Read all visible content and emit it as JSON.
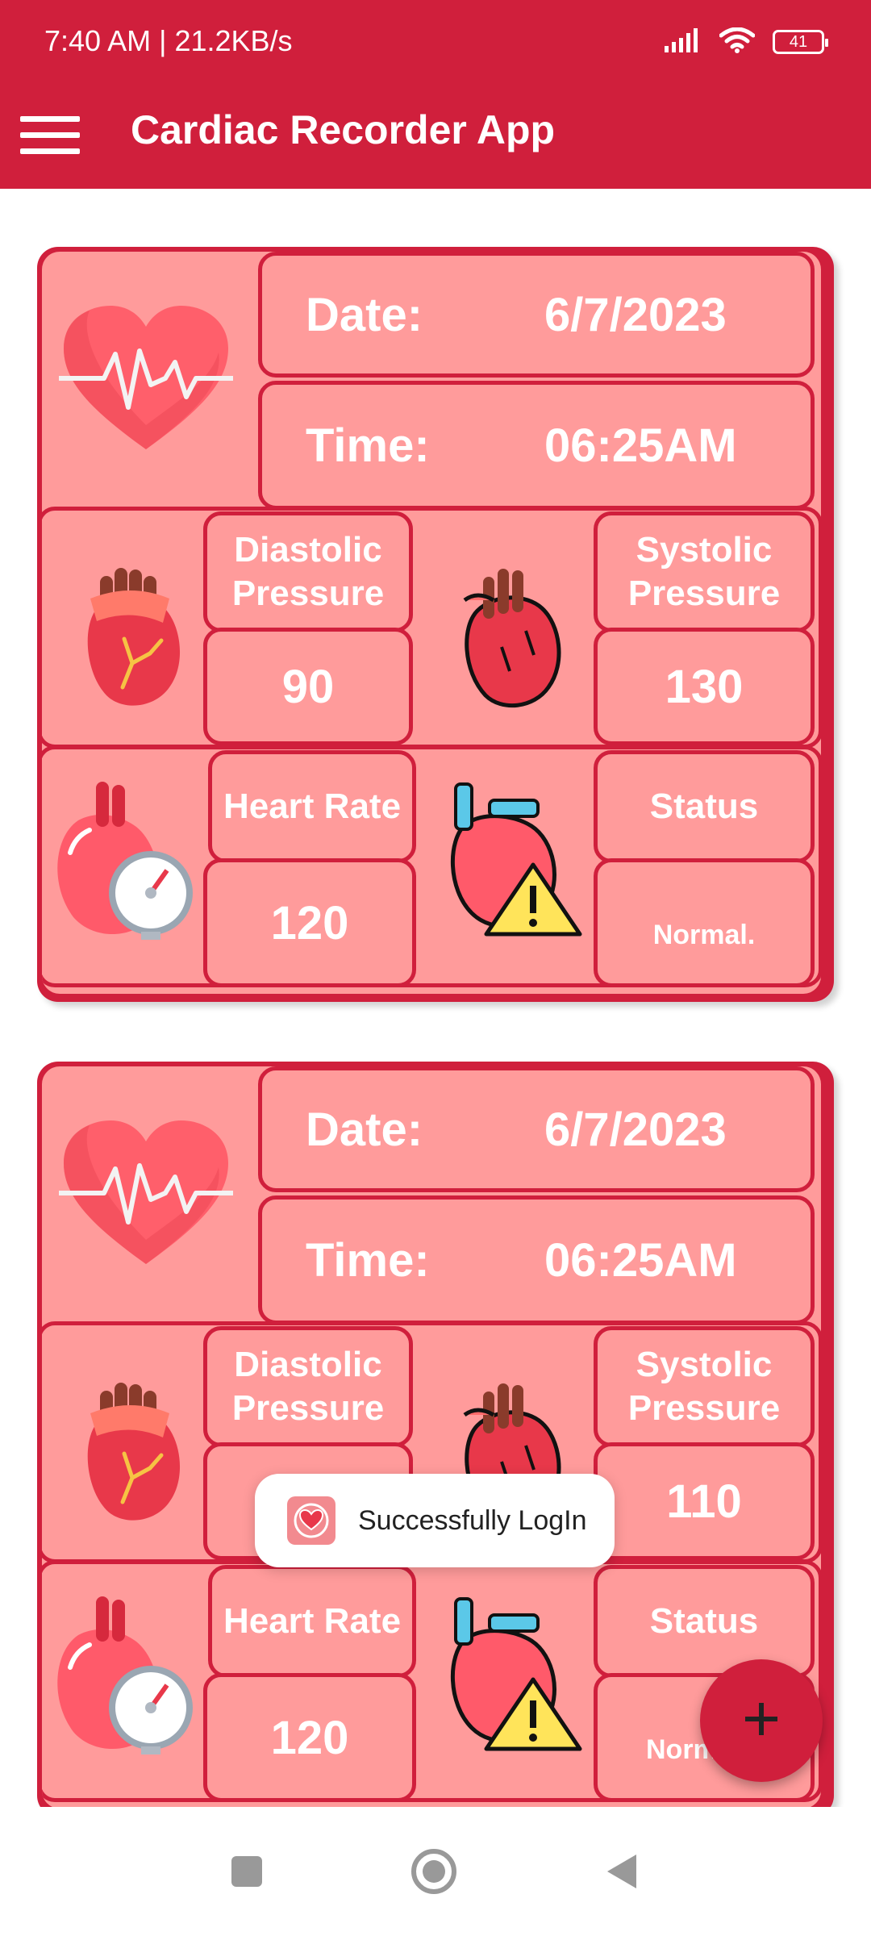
{
  "status_bar": {
    "time": "7:40 AM | 21.2KB/s",
    "battery": "41",
    "icons": [
      "signal-icon",
      "wifi-icon",
      "battery-icon"
    ]
  },
  "app_bar": {
    "title": "Cardiac Recorder App",
    "menu_icon": "hamburger-menu-icon"
  },
  "records": [
    {
      "date_label": "Date:",
      "date": "6/7/2023",
      "time_label": "Time:",
      "time": "06:25AM",
      "diastolic_label": "Diastolic Pressure",
      "diastolic": "90",
      "systolic_label": "Systolic Pressure",
      "systolic": "130",
      "heart_rate_label": "Heart Rate",
      "heart_rate": "120",
      "status_label": "Status",
      "status": "Normal."
    },
    {
      "date_label": "Date:",
      "date": "6/7/2023",
      "time_label": "Time:",
      "time": "06:25AM",
      "diastolic_label": "Diastolic Pressure",
      "diastolic": "",
      "systolic_label": "Systolic Pressure",
      "systolic": "110",
      "heart_rate_label": "Heart Rate",
      "heart_rate": "120",
      "status_label": "Status",
      "status": "Norm"
    }
  ],
  "toast": {
    "message": "Successfully LogIn"
  },
  "fab": {
    "icon": "plus-icon"
  },
  "nav_bar": {
    "items": [
      "recents-square-icon",
      "home-circle-icon",
      "back-triangle-icon"
    ]
  },
  "colors": {
    "primary": "#d01f3c",
    "card_fill": "#ff9b9b",
    "text_on_primary": "#ffffff"
  }
}
